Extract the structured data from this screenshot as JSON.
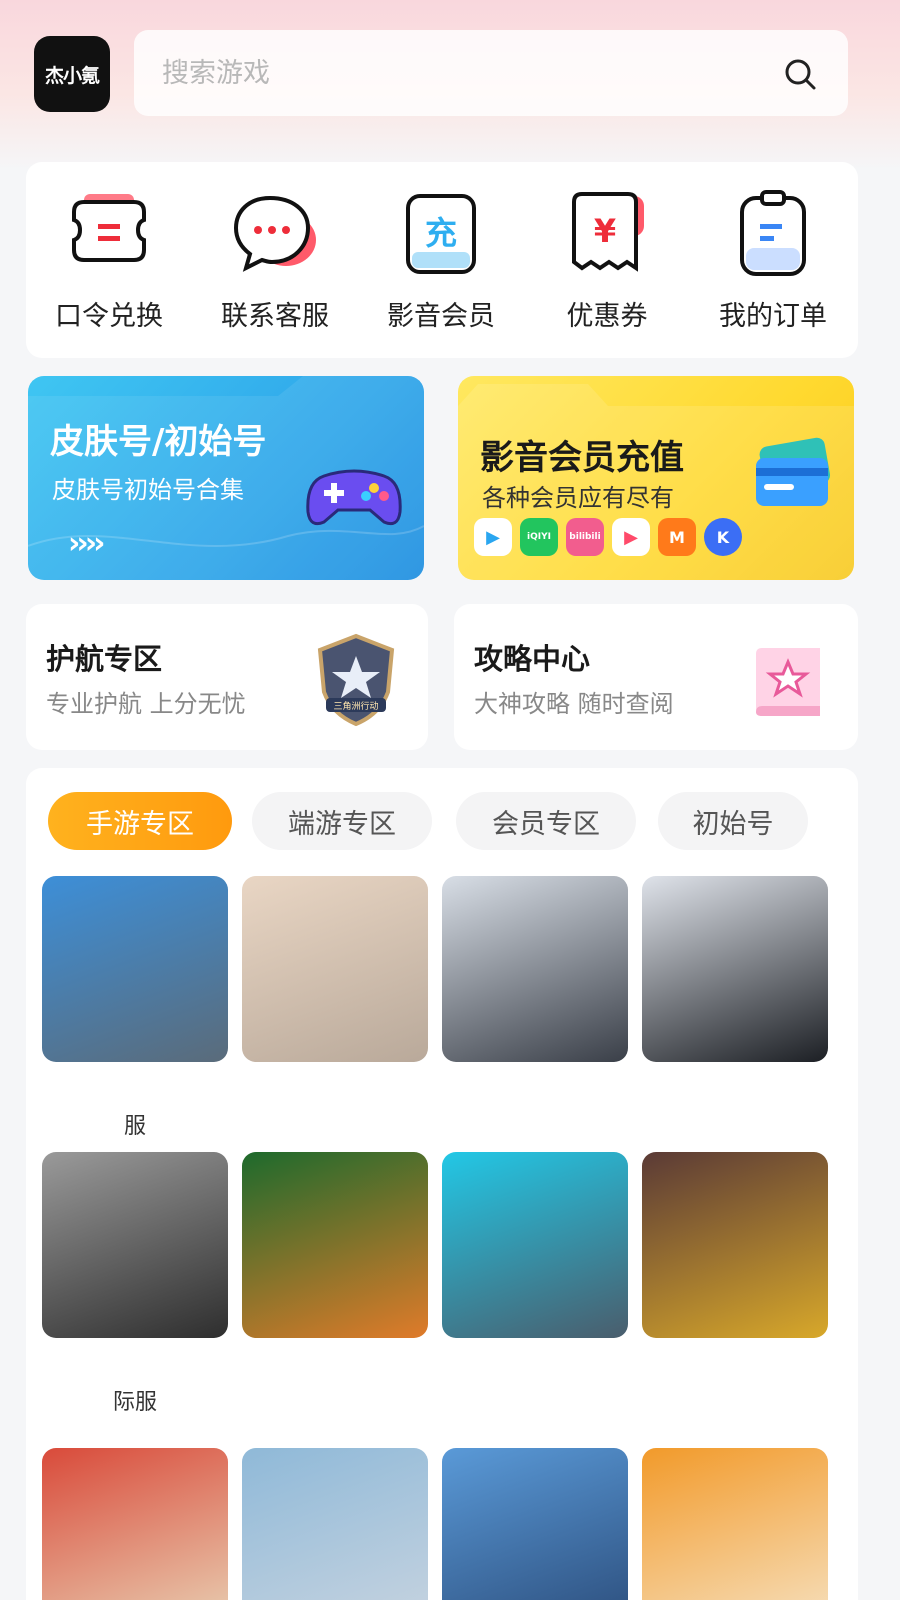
{
  "header": {
    "logo_text": "杰小氪",
    "search_placeholder": "搜索游戏"
  },
  "quick_actions": [
    {
      "label": "口令兑换",
      "icon": "code-exchange-icon",
      "color": "#ee2d3a"
    },
    {
      "label": "联系客服",
      "icon": "chat-bubble-icon",
      "color": "#ee2d3a"
    },
    {
      "label": "影音会员",
      "icon": "recharge-icon",
      "glyph": "充",
      "color": "#2eaef0"
    },
    {
      "label": "优惠券",
      "icon": "coupon-icon",
      "glyph": "¥",
      "color": "#ee2d3a"
    },
    {
      "label": "我的订单",
      "icon": "order-clipboard-icon",
      "color": "#3a86f5"
    }
  ],
  "banners": {
    "left": {
      "title": "皮肤号/初始号",
      "subtitle": "皮肤号初始号合集",
      "arrows": "››››"
    },
    "right": {
      "title": "影音会员充值",
      "subtitle": "各种会员应有尽有",
      "apps": [
        {
          "name": "play-app-icon",
          "text": "▶",
          "color": "#ffffff"
        },
        {
          "name": "iqiyi-app-icon",
          "text": "iQIYI",
          "color": "#22c55e"
        },
        {
          "name": "bilibili-app-icon",
          "text": "bilibili",
          "color": "#f25d8e"
        },
        {
          "name": "tencent-video-app-icon",
          "text": "▶",
          "color": "#ffffff"
        },
        {
          "name": "mgtv-app-icon",
          "text": "M",
          "color": "#ff7a1a"
        },
        {
          "name": "kugou-app-icon",
          "text": "K",
          "color": "#3b6ef5"
        }
      ]
    }
  },
  "zones": {
    "left": {
      "title": "护航专区",
      "subtitle": "专业护航 上分无忧",
      "badge": "三角洲行动"
    },
    "right": {
      "title": "攻略中心",
      "subtitle": "大神攻略 随时查阅"
    }
  },
  "categories": {
    "tabs": [
      "手游专区",
      "端游专区",
      "会员专区",
      "初始号"
    ],
    "active_index": 0,
    "games": [
      {
        "name": "服",
        "color_top": "#3d8fd8",
        "color_bottom": "#5a6b7a"
      },
      {
        "name": "",
        "color_top": "#e9d6c4",
        "color_bottom": "#b9a99a"
      },
      {
        "name": "",
        "color_top": "#d8dee6",
        "color_bottom": "#3a3f48"
      },
      {
        "name": "",
        "color_top": "#dfe3ea",
        "color_bottom": "#1c1f24"
      },
      {
        "name": "际服",
        "color_top": "#9a9a9a",
        "color_bottom": "#2e2e2e"
      },
      {
        "name": "",
        "color_top": "#1d6a2c",
        "color_bottom": "#e07b2a"
      },
      {
        "name": "",
        "color_top": "#22c8e6",
        "color_bottom": "#4a5d6c"
      },
      {
        "name": "",
        "color_top": "#5a3a36",
        "color_bottom": "#d8a82a"
      },
      {
        "name": "",
        "color_top": "#d94a3a",
        "color_bottom": "#e9d3b6"
      },
      {
        "name": "",
        "color_top": "#8fb9d8",
        "color_bottom": "#c8d4e0"
      },
      {
        "name": "",
        "color_top": "#5a9ad8",
        "color_bottom": "#2b4c7a"
      },
      {
        "name": "",
        "color_top": "#f29a2a",
        "color_bottom": "#f6e2c2"
      }
    ]
  }
}
